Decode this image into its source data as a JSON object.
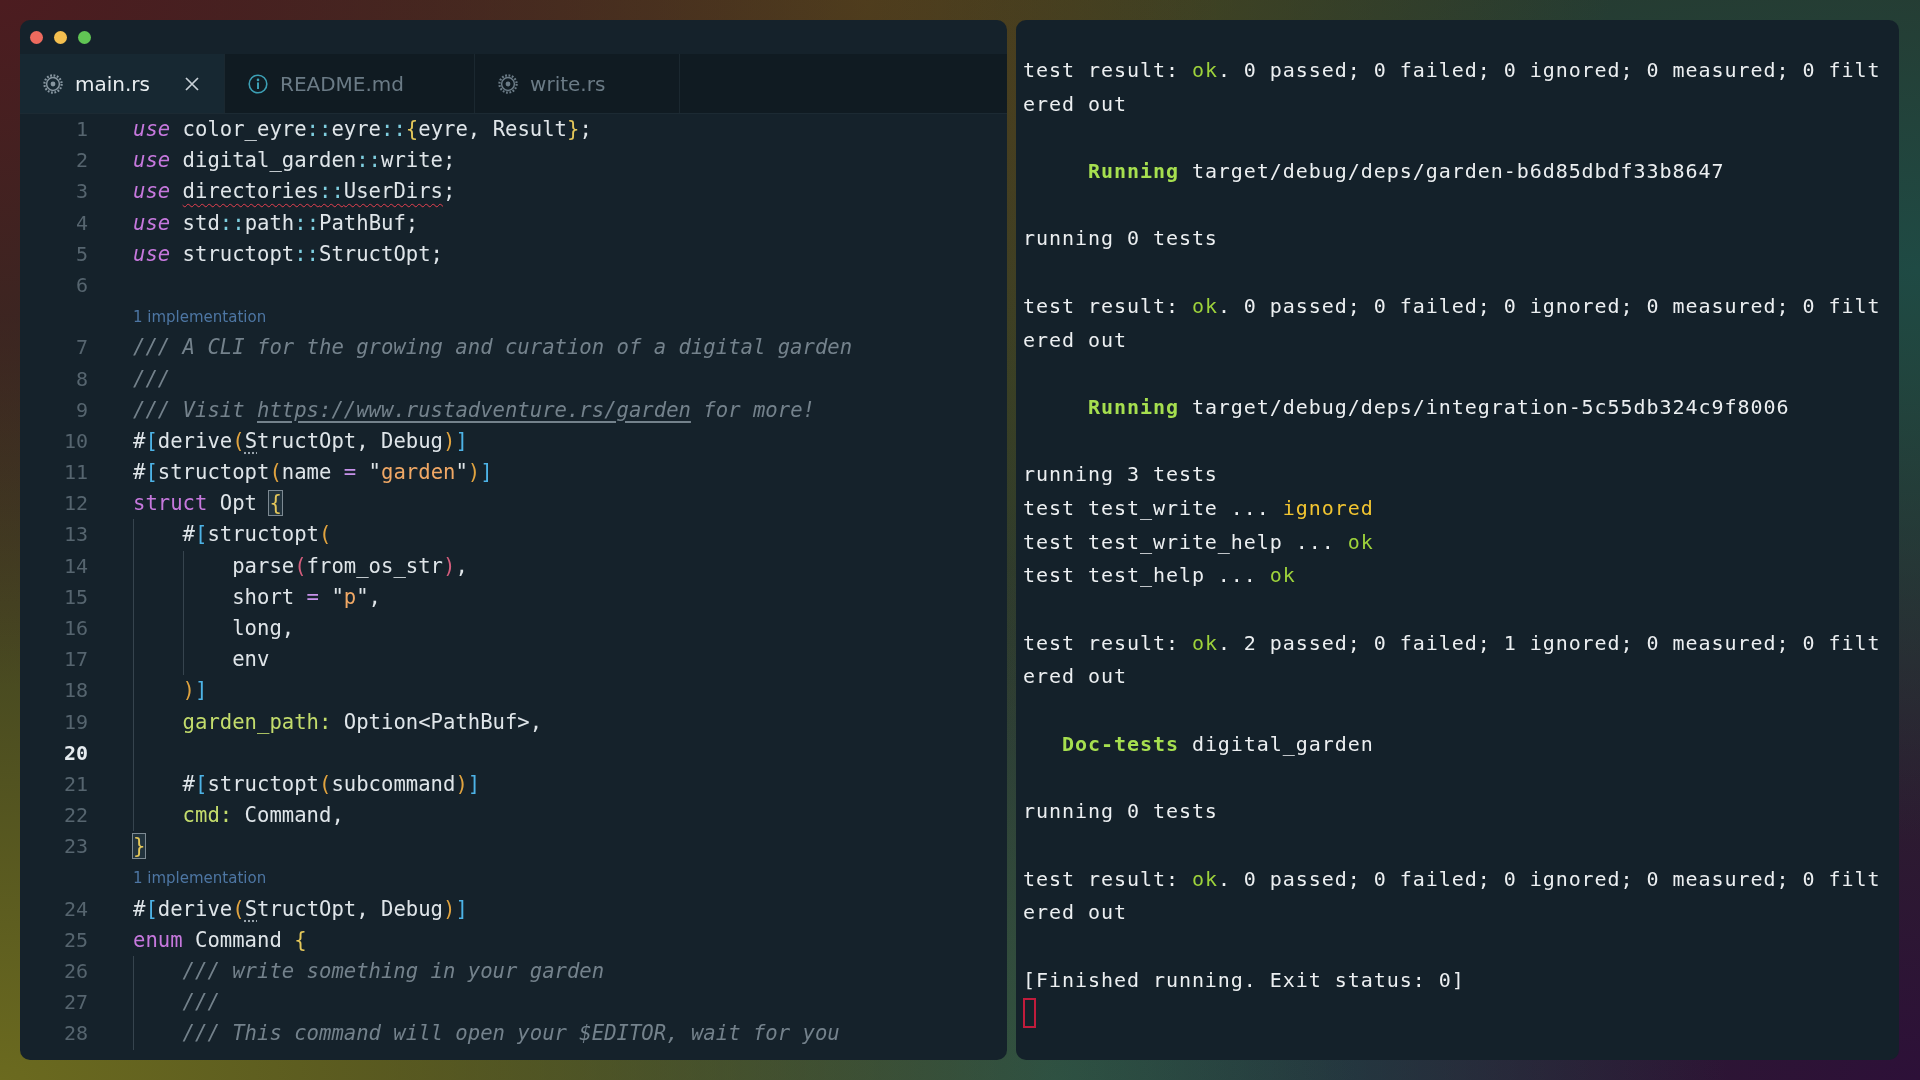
{
  "editor": {
    "tabs": [
      {
        "label": "main.rs",
        "kind": "rust",
        "selected": true
      },
      {
        "label": "README.md",
        "kind": "markdown",
        "selected": false
      },
      {
        "label": "write.rs",
        "kind": "rust",
        "selected": false
      }
    ],
    "lines": [
      {
        "kind": "code",
        "number": "1",
        "current": false,
        "tokens": [
          {
            "kind": "keyword-italic",
            "text": "use"
          },
          {
            "kind": "plain",
            "text": " color_eyre"
          },
          {
            "kind": "path",
            "text": "::"
          },
          {
            "kind": "plain",
            "text": "eyre"
          },
          {
            "kind": "path",
            "text": "::"
          },
          {
            "kind": "brace",
            "text": "{"
          },
          {
            "kind": "plain",
            "text": "eyre, Result"
          },
          {
            "kind": "brace",
            "text": "}"
          },
          {
            "kind": "plain",
            "text": ";"
          }
        ]
      },
      {
        "kind": "code",
        "number": "2",
        "current": false,
        "tokens": [
          {
            "kind": "keyword-italic",
            "text": "use"
          },
          {
            "kind": "plain",
            "text": " digital_garden"
          },
          {
            "kind": "path",
            "text": "::"
          },
          {
            "kind": "plain",
            "text": "write;"
          }
        ]
      },
      {
        "kind": "code",
        "number": "3",
        "current": false,
        "tokens": [
          {
            "kind": "keyword-italic",
            "text": "use "
          },
          {
            "kind": "error",
            "parts": [
              {
                "kind": "plain",
                "text": "directories"
              },
              {
                "kind": "path",
                "text": "::"
              },
              {
                "kind": "plain",
                "text": "UserDirs"
              }
            ]
          },
          {
            "kind": "plain",
            "text": ";"
          }
        ]
      },
      {
        "kind": "code",
        "number": "4",
        "current": false,
        "tokens": [
          {
            "kind": "keyword-italic",
            "text": "use"
          },
          {
            "kind": "plain",
            "text": " std"
          },
          {
            "kind": "path",
            "text": "::"
          },
          {
            "kind": "plain",
            "text": "path"
          },
          {
            "kind": "path",
            "text": "::"
          },
          {
            "kind": "plain",
            "text": "PathBuf;"
          }
        ]
      },
      {
        "kind": "code",
        "number": "5",
        "current": false,
        "tokens": [
          {
            "kind": "keyword-italic",
            "text": "use"
          },
          {
            "kind": "plain",
            "text": " structopt"
          },
          {
            "kind": "path",
            "text": "::"
          },
          {
            "kind": "plain",
            "text": "StructOpt;"
          }
        ]
      },
      {
        "kind": "code",
        "number": "6",
        "current": false
      },
      {
        "kind": "codelens",
        "text": "1 implementation"
      },
      {
        "kind": "code",
        "number": "7",
        "current": false,
        "tokens": [
          {
            "kind": "comment",
            "text": "/// A CLI for the growing and curation of a digital garden"
          }
        ]
      },
      {
        "kind": "code",
        "number": "8",
        "current": false,
        "tokens": [
          {
            "kind": "comment",
            "text": "///"
          }
        ]
      },
      {
        "kind": "code",
        "number": "9",
        "current": false,
        "tokens": [
          {
            "kind": "comment",
            "text": "/// Visit "
          },
          {
            "kind": "link",
            "text": "https://www.rustadventure.rs/garden"
          },
          {
            "kind": "comment",
            "text": " for more!"
          }
        ]
      },
      {
        "kind": "code",
        "number": "10",
        "current": false,
        "tokens": [
          {
            "kind": "plain",
            "text": "#"
          },
          {
            "kind": "square",
            "text": "["
          },
          {
            "kind": "plain",
            "text": "derive"
          },
          {
            "kind": "paren",
            "text": "("
          },
          {
            "kind": "hint",
            "text": "S"
          },
          {
            "kind": "plain",
            "text": "tructOpt, Debug"
          },
          {
            "kind": "paren",
            "text": ")"
          },
          {
            "kind": "square",
            "text": "]"
          }
        ]
      },
      {
        "kind": "code",
        "number": "11",
        "current": false,
        "tokens": [
          {
            "kind": "plain",
            "text": "#"
          },
          {
            "kind": "square",
            "text": "["
          },
          {
            "kind": "plain",
            "text": "structopt"
          },
          {
            "kind": "paren",
            "text": "("
          },
          {
            "kind": "plain",
            "text": "name "
          },
          {
            "kind": "operator",
            "text": "="
          },
          {
            "kind": "plain",
            "text": " \""
          },
          {
            "kind": "string",
            "text": "garden"
          },
          {
            "kind": "plain",
            "text": "\""
          },
          {
            "kind": "paren",
            "text": ")"
          },
          {
            "kind": "square",
            "text": "]"
          }
        ]
      },
      {
        "kind": "code",
        "number": "12",
        "current": false,
        "tokens": [
          {
            "kind": "keyword",
            "text": "struct"
          },
          {
            "kind": "plain",
            "text": " Opt "
          },
          {
            "kind": "brace-match",
            "text": "{"
          }
        ]
      },
      {
        "kind": "code",
        "number": "13",
        "current": false,
        "tokens": [
          {
            "kind": "plain",
            "text": "    #"
          },
          {
            "kind": "square",
            "text": "["
          },
          {
            "kind": "plain",
            "text": "structopt"
          },
          {
            "kind": "paren",
            "text": "("
          }
        ]
      },
      {
        "kind": "code",
        "number": "14",
        "current": false,
        "tokens": [
          {
            "kind": "plain",
            "text": "        parse"
          },
          {
            "kind": "paren-inner",
            "text": "("
          },
          {
            "kind": "plain",
            "text": "from_os_str"
          },
          {
            "kind": "paren-inner",
            "text": ")"
          },
          {
            "kind": "plain",
            "text": ","
          }
        ]
      },
      {
        "kind": "code",
        "number": "15",
        "current": false,
        "tokens": [
          {
            "kind": "plain",
            "text": "        short "
          },
          {
            "kind": "operator",
            "text": "="
          },
          {
            "kind": "plain",
            "text": " \""
          },
          {
            "kind": "string",
            "text": "p"
          },
          {
            "kind": "plain",
            "text": "\","
          }
        ]
      },
      {
        "kind": "code",
        "number": "16",
        "current": false,
        "tokens": [
          {
            "kind": "plain",
            "text": "        long,"
          }
        ]
      },
      {
        "kind": "code",
        "number": "17",
        "current": false,
        "tokens": [
          {
            "kind": "plain",
            "text": "        env"
          }
        ]
      },
      {
        "kind": "code",
        "number": "18",
        "current": false,
        "tokens": [
          {
            "kind": "paren",
            "text": "    )"
          },
          {
            "kind": "square",
            "text": "]"
          }
        ]
      },
      {
        "kind": "code",
        "number": "19",
        "current": false,
        "tokens": [
          {
            "kind": "field",
            "text": "    garden_path:"
          },
          {
            "kind": "plain",
            "text": " Option<PathBuf>,"
          }
        ]
      },
      {
        "kind": "code",
        "number": "20",
        "current": true
      },
      {
        "kind": "code",
        "number": "21",
        "current": false,
        "tokens": [
          {
            "kind": "plain",
            "text": "    #"
          },
          {
            "kind": "square",
            "text": "["
          },
          {
            "kind": "plain",
            "text": "structopt"
          },
          {
            "kind": "paren",
            "text": "("
          },
          {
            "kind": "plain",
            "text": "subcommand"
          },
          {
            "kind": "paren",
            "text": ")"
          },
          {
            "kind": "square",
            "text": "]"
          }
        ]
      },
      {
        "kind": "code",
        "number": "22",
        "current": false,
        "tokens": [
          {
            "kind": "field",
            "text": "    cmd:"
          },
          {
            "kind": "plain",
            "text": " Command,"
          }
        ]
      },
      {
        "kind": "code",
        "number": "23",
        "current": false,
        "tokens": [
          {
            "kind": "brace-match",
            "text": "}"
          }
        ]
      },
      {
        "kind": "codelens",
        "text": "1 implementation"
      },
      {
        "kind": "code",
        "number": "24",
        "current": false,
        "tokens": [
          {
            "kind": "plain",
            "text": "#"
          },
          {
            "kind": "square",
            "text": "["
          },
          {
            "kind": "plain",
            "text": "derive"
          },
          {
            "kind": "paren",
            "text": "("
          },
          {
            "kind": "hint",
            "text": "S"
          },
          {
            "kind": "plain",
            "text": "tructOpt, Debug"
          },
          {
            "kind": "paren",
            "text": ")"
          },
          {
            "kind": "square",
            "text": "]"
          }
        ]
      },
      {
        "kind": "code",
        "number": "25",
        "current": false,
        "tokens": [
          {
            "kind": "keyword",
            "text": "enum"
          },
          {
            "kind": "plain",
            "text": " Command "
          },
          {
            "kind": "brace",
            "text": "{"
          }
        ]
      },
      {
        "kind": "code",
        "number": "26",
        "current": false,
        "tokens": [
          {
            "kind": "comment",
            "text": "    /// write something in your garden"
          }
        ]
      },
      {
        "kind": "code",
        "number": "27",
        "current": false,
        "tokens": [
          {
            "kind": "comment",
            "text": "    ///"
          }
        ]
      },
      {
        "kind": "code",
        "number": "28",
        "current": false,
        "tokens": [
          {
            "kind": "comment",
            "text": "    /// This command will open your $EDITOR, wait for you"
          }
        ]
      }
    ]
  },
  "terminal": {
    "blocks": [
      {
        "lines": [
          [
            {
              "kind": "plain",
              "text": "test result: "
            },
            {
              "kind": "ok",
              "text": "ok"
            },
            {
              "kind": "plain",
              "text": ". 0 passed; 0 failed; 0 ignored; 0 measured; 0 filt"
            }
          ],
          [
            {
              "kind": "plain",
              "text": "ered out"
            }
          ]
        ]
      },
      {
        "lines": [
          [
            {
              "kind": "status",
              "text": "Running"
            },
            {
              "kind": "plain",
              "text": "target/debug/deps/garden-b6d85dbdf33b8647"
            }
          ]
        ]
      },
      {
        "lines": [
          [
            {
              "kind": "plain",
              "text": "running 0 tests"
            }
          ]
        ]
      },
      {
        "lines": [
          [
            {
              "kind": "plain",
              "text": "test result: "
            },
            {
              "kind": "ok",
              "text": "ok"
            },
            {
              "kind": "plain",
              "text": ". 0 passed; 0 failed; 0 ignored; 0 measured; 0 filt"
            }
          ],
          [
            {
              "kind": "plain",
              "text": "ered out"
            }
          ]
        ]
      },
      {
        "lines": [
          [
            {
              "kind": "status",
              "text": "Running"
            },
            {
              "kind": "plain",
              "text": "target/debug/deps/integration-5c55db324c9f8006"
            }
          ]
        ]
      },
      {
        "lines": [
          [
            {
              "kind": "plain",
              "text": "running 3 tests"
            }
          ],
          [
            {
              "kind": "plain",
              "text": "test test_write ... "
            },
            {
              "kind": "ignored",
              "text": "ignored"
            }
          ],
          [
            {
              "kind": "plain",
              "text": "test test_write_help ... "
            },
            {
              "kind": "ok",
              "text": "ok"
            }
          ],
          [
            {
              "kind": "plain",
              "text": "test test_help ... "
            },
            {
              "kind": "ok",
              "text": "ok"
            }
          ]
        ]
      },
      {
        "lines": [
          [
            {
              "kind": "plain",
              "text": "test result: "
            },
            {
              "kind": "ok",
              "text": "ok"
            },
            {
              "kind": "plain",
              "text": ". 2 passed; 0 failed; 1 ignored; 0 measured; 0 filt"
            }
          ],
          [
            {
              "kind": "plain",
              "text": "ered out"
            }
          ]
        ]
      },
      {
        "lines": [
          [
            {
              "kind": "status",
              "text": "Doc-tests"
            },
            {
              "kind": "plain",
              "text": "digital_garden"
            }
          ]
        ]
      },
      {
        "lines": [
          [
            {
              "kind": "plain",
              "text": "running 0 tests"
            }
          ]
        ]
      },
      {
        "lines": [
          [
            {
              "kind": "plain",
              "text": "test result: "
            },
            {
              "kind": "ok",
              "text": "ok"
            },
            {
              "kind": "plain",
              "text": ". 0 passed; 0 failed; 0 ignored; 0 measured; 0 filt"
            }
          ],
          [
            {
              "kind": "plain",
              "text": "ered out"
            }
          ]
        ]
      },
      {
        "lines": [
          [
            {
              "kind": "plain",
              "text": "[Finished running. Exit status: 0]"
            }
          ]
        ]
      }
    ]
  }
}
